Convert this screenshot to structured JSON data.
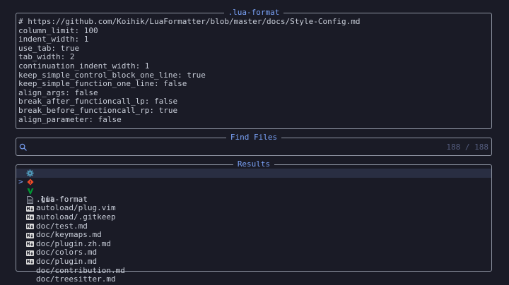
{
  "preview": {
    "title": ".lua-format",
    "lines": [
      "# https://github.com/Koihik/LuaFormatter/blob/master/docs/Style-Config.md",
      "column_limit: 100",
      "indent_width: 1",
      "use_tab: true",
      "tab_width: 2",
      "continuation_indent_width: 1",
      "keep_simple_control_block_one_line: true",
      "keep_simple_function_one_line: false",
      "align_args: false",
      "break_after_functioncall_lp: false",
      "break_before_functioncall_rp: true",
      "align_parameter: false"
    ]
  },
  "prompt": {
    "title": "Find Files",
    "value": "",
    "count": "188 / 188",
    "icon": "search-icon"
  },
  "results": {
    "title": "Results",
    "caret": ">",
    "items": [
      {
        "name": ".lua-format",
        "icon": "gear-icon",
        "selected": true
      },
      {
        "name": ".git",
        "icon": "git-icon"
      },
      {
        "name": "autoload/plug.vim",
        "icon": "vim-icon"
      },
      {
        "name": "autoload/.gitkeep",
        "icon": "file-icon"
      },
      {
        "name": "doc/test.md",
        "icon": "markdown-icon"
      },
      {
        "name": "doc/keymaps.md",
        "icon": "markdown-icon"
      },
      {
        "name": "doc/plugin.zh.md",
        "icon": "markdown-icon"
      },
      {
        "name": "doc/colors.md",
        "icon": "markdown-icon"
      },
      {
        "name": "doc/plugin.md",
        "icon": "markdown-icon"
      },
      {
        "name": "doc/contribution.md",
        "icon": "markdown-icon"
      },
      {
        "name": "doc/treesitter.md",
        "icon": "markdown-icon"
      }
    ]
  },
  "colors": {
    "background": "#1a1b26",
    "border": "#8f95a3",
    "title": "#7aa2f7",
    "text": "#c8cdd8",
    "selection": "#292e42",
    "count": "#545c7e",
    "gear_icon": "#519aba",
    "git_icon": "#f14c28",
    "vim_icon": "#019833",
    "markdown_icon": "#dadada"
  }
}
